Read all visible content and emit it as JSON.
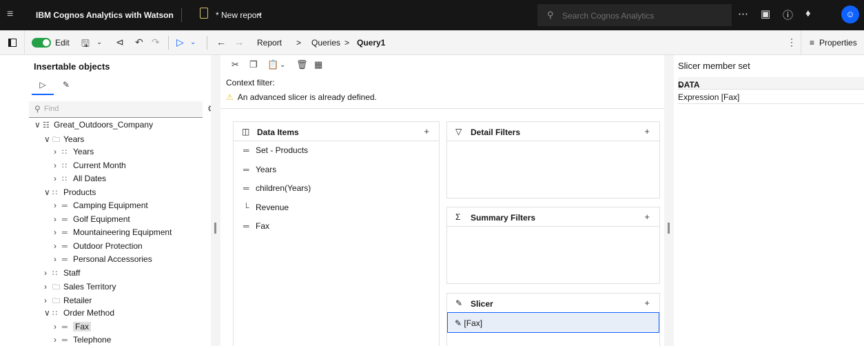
{
  "topbar": {
    "app_name_bold": "IBM Cognos Analytics with Watson",
    "report_title": "* New report",
    "search_placeholder": "Search Cognos Analytics",
    "avatar_icon": "user-icon"
  },
  "toolbar": {
    "edit_label": "Edit",
    "breadcrumb": [
      "Report",
      "Queries",
      "Query1"
    ],
    "properties_label": "Properties"
  },
  "left": {
    "title": "Insertable objects",
    "find_placeholder": "Find",
    "tree": [
      {
        "label": "Great_Outdoors_Company",
        "twisty": "v",
        "icon": "grid-icon"
      },
      {
        "label": "Years",
        "twisty": "v",
        "icon": "folder-icon"
      },
      {
        "label": "Years",
        "twisty": ">",
        "icon": "hierarchy-icon"
      },
      {
        "label": "Current Month",
        "twisty": ">",
        "icon": "hierarchy-icon"
      },
      {
        "label": "All Dates",
        "twisty": ">",
        "icon": "hierarchy-icon"
      },
      {
        "label": "Products",
        "twisty": "v",
        "icon": "hierarchy-icon"
      },
      {
        "label": "Camping Equipment",
        "twisty": ">",
        "icon": "member-icon"
      },
      {
        "label": "Golf Equipment",
        "twisty": ">",
        "icon": "member-icon"
      },
      {
        "label": "Mountaineering Equipment",
        "twisty": ">",
        "icon": "member-icon"
      },
      {
        "label": "Outdoor Protection",
        "twisty": ">",
        "icon": "member-icon"
      },
      {
        "label": "Personal Accessories",
        "twisty": ">",
        "icon": "member-icon"
      },
      {
        "label": "Staff",
        "twisty": ">",
        "icon": "hierarchy-icon"
      },
      {
        "label": "Sales Territory",
        "twisty": ">",
        "icon": "folder-icon"
      },
      {
        "label": "Retailer",
        "twisty": ">",
        "icon": "folder-icon"
      },
      {
        "label": "Order Method",
        "twisty": "v",
        "icon": "hierarchy-icon"
      },
      {
        "label": "Fax",
        "twisty": ">",
        "icon": "member-icon",
        "selected": true
      },
      {
        "label": "Telephone",
        "twisty": ">",
        "icon": "member-icon"
      }
    ]
  },
  "center": {
    "context_filter_label": "Context filter:",
    "context_warning": "An advanced slicer is already defined.",
    "data_items": {
      "title": "Data Items",
      "items": [
        {
          "label": "Set - Products",
          "icon": "member-icon"
        },
        {
          "label": "Years",
          "icon": "member-icon"
        },
        {
          "label": "children(Years)",
          "icon": "member-icon"
        },
        {
          "label": "Revenue",
          "icon": "measure-icon"
        },
        {
          "label": "Fax",
          "icon": "member-icon"
        }
      ]
    },
    "detail_filters": {
      "title": "Detail Filters"
    },
    "summary_filters": {
      "title": "Summary Filters"
    },
    "slicer": {
      "title": "Slicer",
      "items": [
        "[Fax]"
      ]
    }
  },
  "right": {
    "title": "Slicer member set",
    "section": "DATA",
    "property": "Expression [Fax]"
  }
}
